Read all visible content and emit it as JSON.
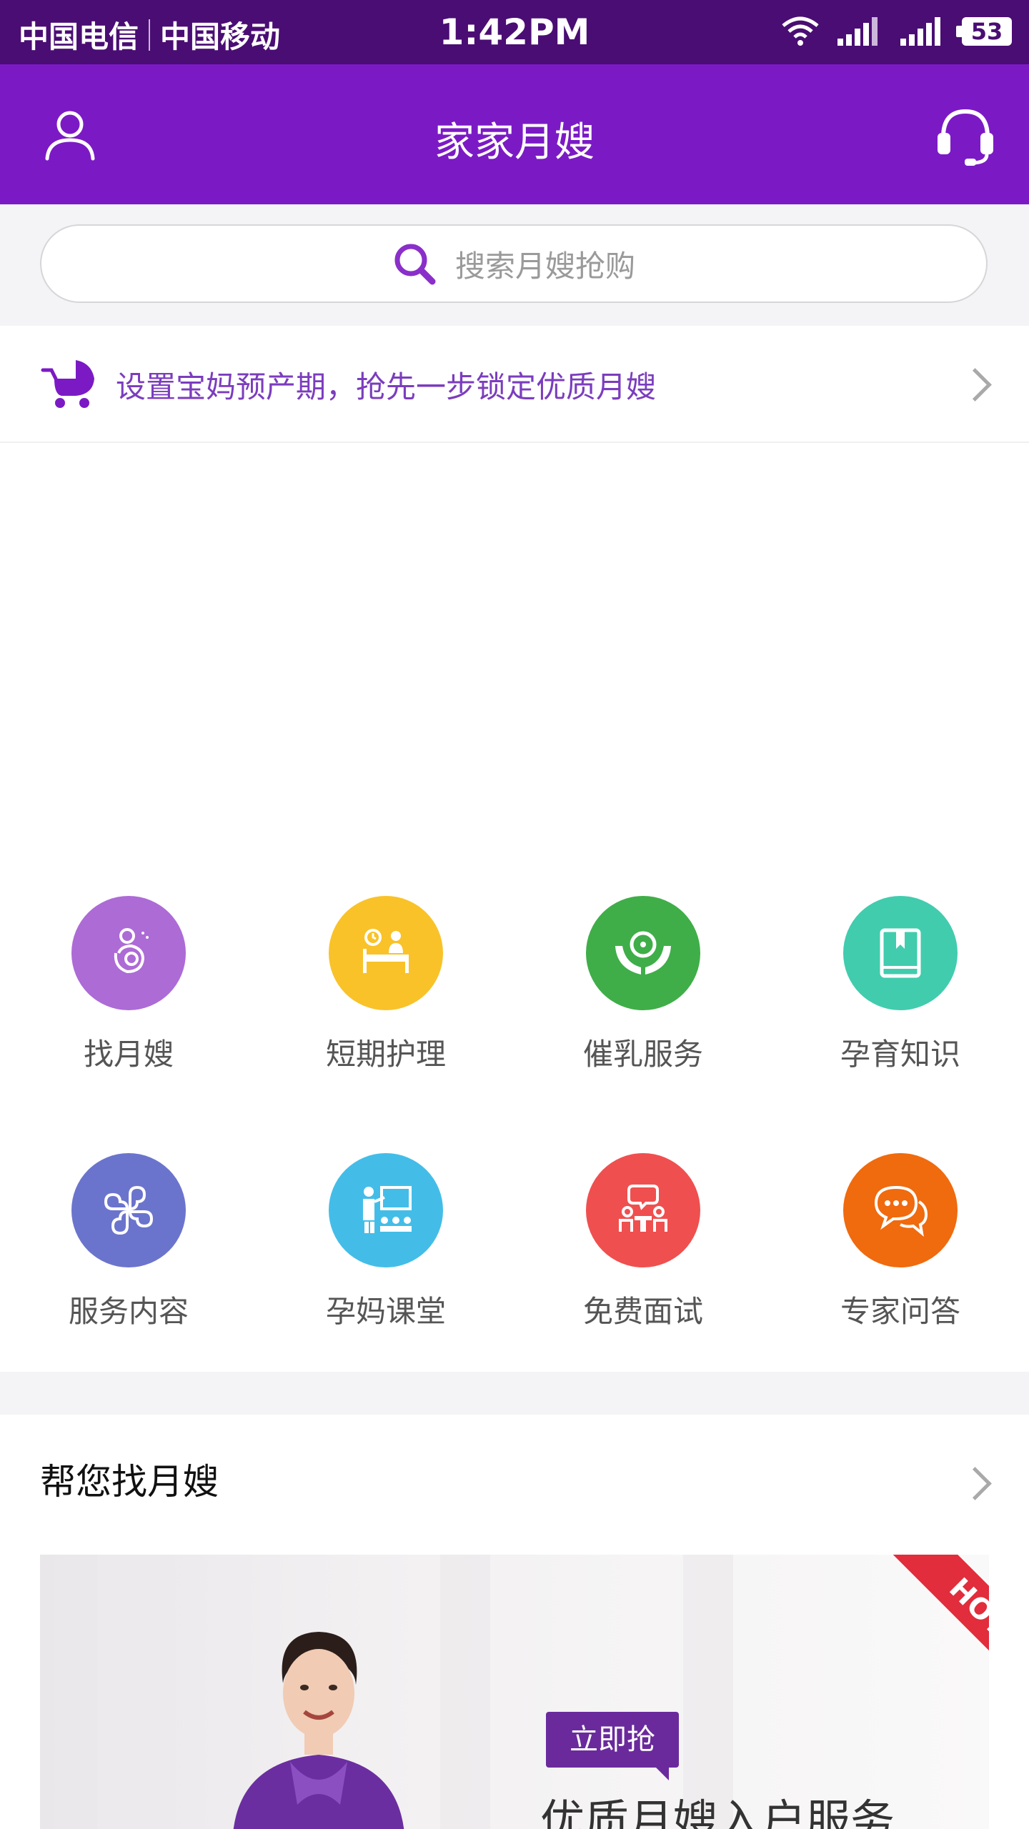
{
  "status_bar": {
    "carrier1": "中国电信",
    "carrier2": "中国移动",
    "time": "1:42PM",
    "battery": "53"
  },
  "header": {
    "title": "家家月嫂",
    "left_icon": "user-icon",
    "right_icon": "headset-icon",
    "color": "#7b1ac5"
  },
  "search": {
    "placeholder": "搜索月嫂抢购"
  },
  "promo": {
    "text": "设置宝妈预产期，抢先一步锁定优质月嫂",
    "icon": "stroller-icon"
  },
  "services": [
    {
      "label": "找月嫂",
      "icon": "mother-baby-icon",
      "color": "#ad6bd6"
    },
    {
      "label": "短期护理",
      "icon": "nursing-bed-icon",
      "color": "#f9c228"
    },
    {
      "label": "催乳服务",
      "icon": "hands-care-icon",
      "color": "#3fae48"
    },
    {
      "label": "孕育知识",
      "icon": "book-icon",
      "color": "#41ccae"
    },
    {
      "label": "服务内容",
      "icon": "grid-petals-icon",
      "color": "#6b74cc"
    },
    {
      "label": "孕妈课堂",
      "icon": "classroom-icon",
      "color": "#43bde8"
    },
    {
      "label": "免费面试",
      "icon": "interview-icon",
      "color": "#f04f4f"
    },
    {
      "label": "专家问答",
      "icon": "chat-bubbles-icon",
      "color": "#f06a0e"
    }
  ],
  "section": {
    "title": "帮您找月嫂"
  },
  "card": {
    "hot": "HOT",
    "tag": "立即抢",
    "title": "优质月嫂入户服务"
  }
}
